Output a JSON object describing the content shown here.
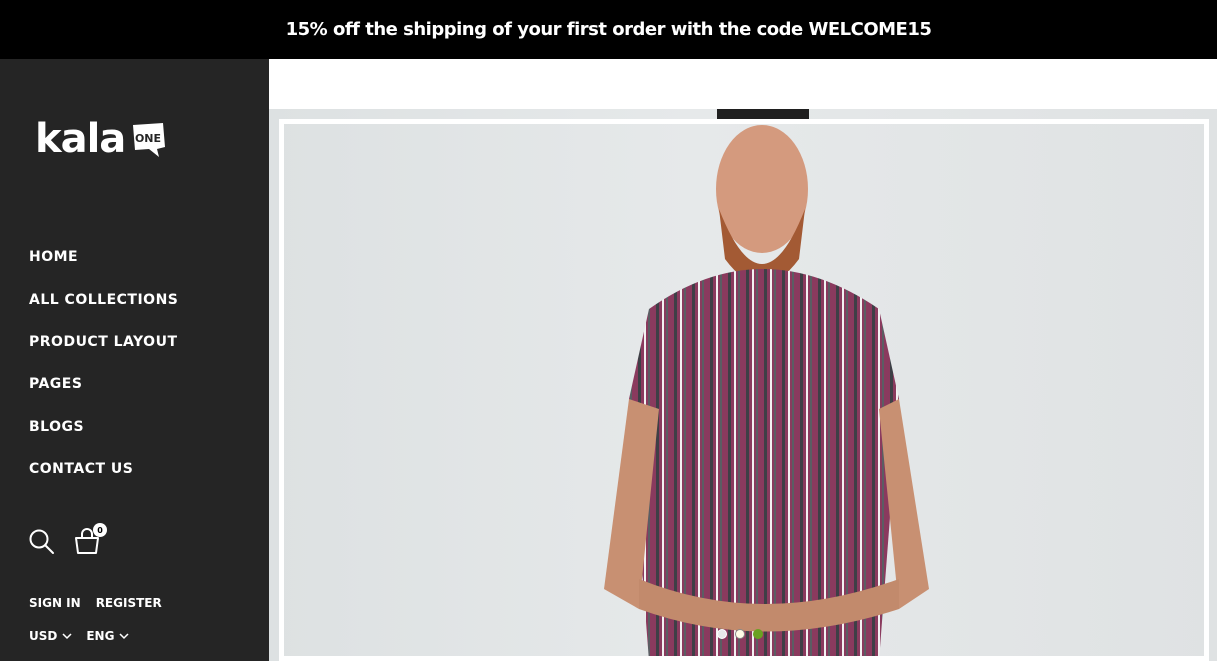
{
  "announcement": {
    "text": "15% off the shipping of your first order with the code WELCOME15"
  },
  "logo": {
    "text": "kala",
    "badge_text": "ONE"
  },
  "nav": {
    "items": [
      {
        "label": "HOME"
      },
      {
        "label": "ALL COLLECTIONS"
      },
      {
        "label": "PRODUCT LAYOUT"
      },
      {
        "label": "PAGES"
      },
      {
        "label": "BLOGS"
      },
      {
        "label": "CONTACT US"
      }
    ]
  },
  "header_icons": {
    "search": "search-icon",
    "cart": "cart-icon",
    "cart_count": "0"
  },
  "account": {
    "sign_in": "SIGN IN",
    "register": "REGISTER"
  },
  "selectors": {
    "currency": "USD",
    "language": "ENG"
  },
  "slider": {
    "active_index": 2,
    "dots": 3,
    "colors": {
      "dot_inactive": "#ffffff",
      "dot_active": "#6aa121",
      "shirt": "#8a3a5e"
    }
  },
  "colors": {
    "topbar": "#000000",
    "sidebar": "#252525",
    "text": "#ffffff"
  }
}
